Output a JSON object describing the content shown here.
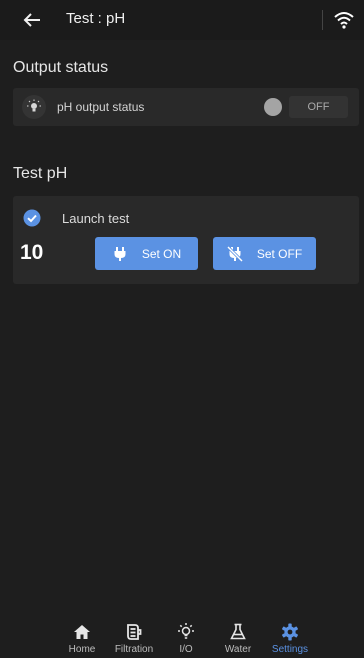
{
  "header": {
    "title": "Test : pH"
  },
  "output_section": {
    "title": "Output status",
    "label": "pH output status",
    "off_label": "OFF"
  },
  "test_section": {
    "title": "Test pH",
    "launch_label": "Launch test",
    "count": "10",
    "set_on_label": "Set ON",
    "set_off_label": "Set OFF"
  },
  "nav": {
    "items": [
      {
        "label": "Home",
        "icon": "home-icon"
      },
      {
        "label": "Filtration",
        "icon": "filter-icon"
      },
      {
        "label": "I/O",
        "icon": "lightbulb-icon"
      },
      {
        "label": "Water",
        "icon": "flask-icon"
      },
      {
        "label": "Settings",
        "icon": "gear-icon"
      }
    ],
    "active": "Settings"
  },
  "colors": {
    "accent": "#5b92e3",
    "background": "#1e1e1e",
    "card": "#292929"
  }
}
